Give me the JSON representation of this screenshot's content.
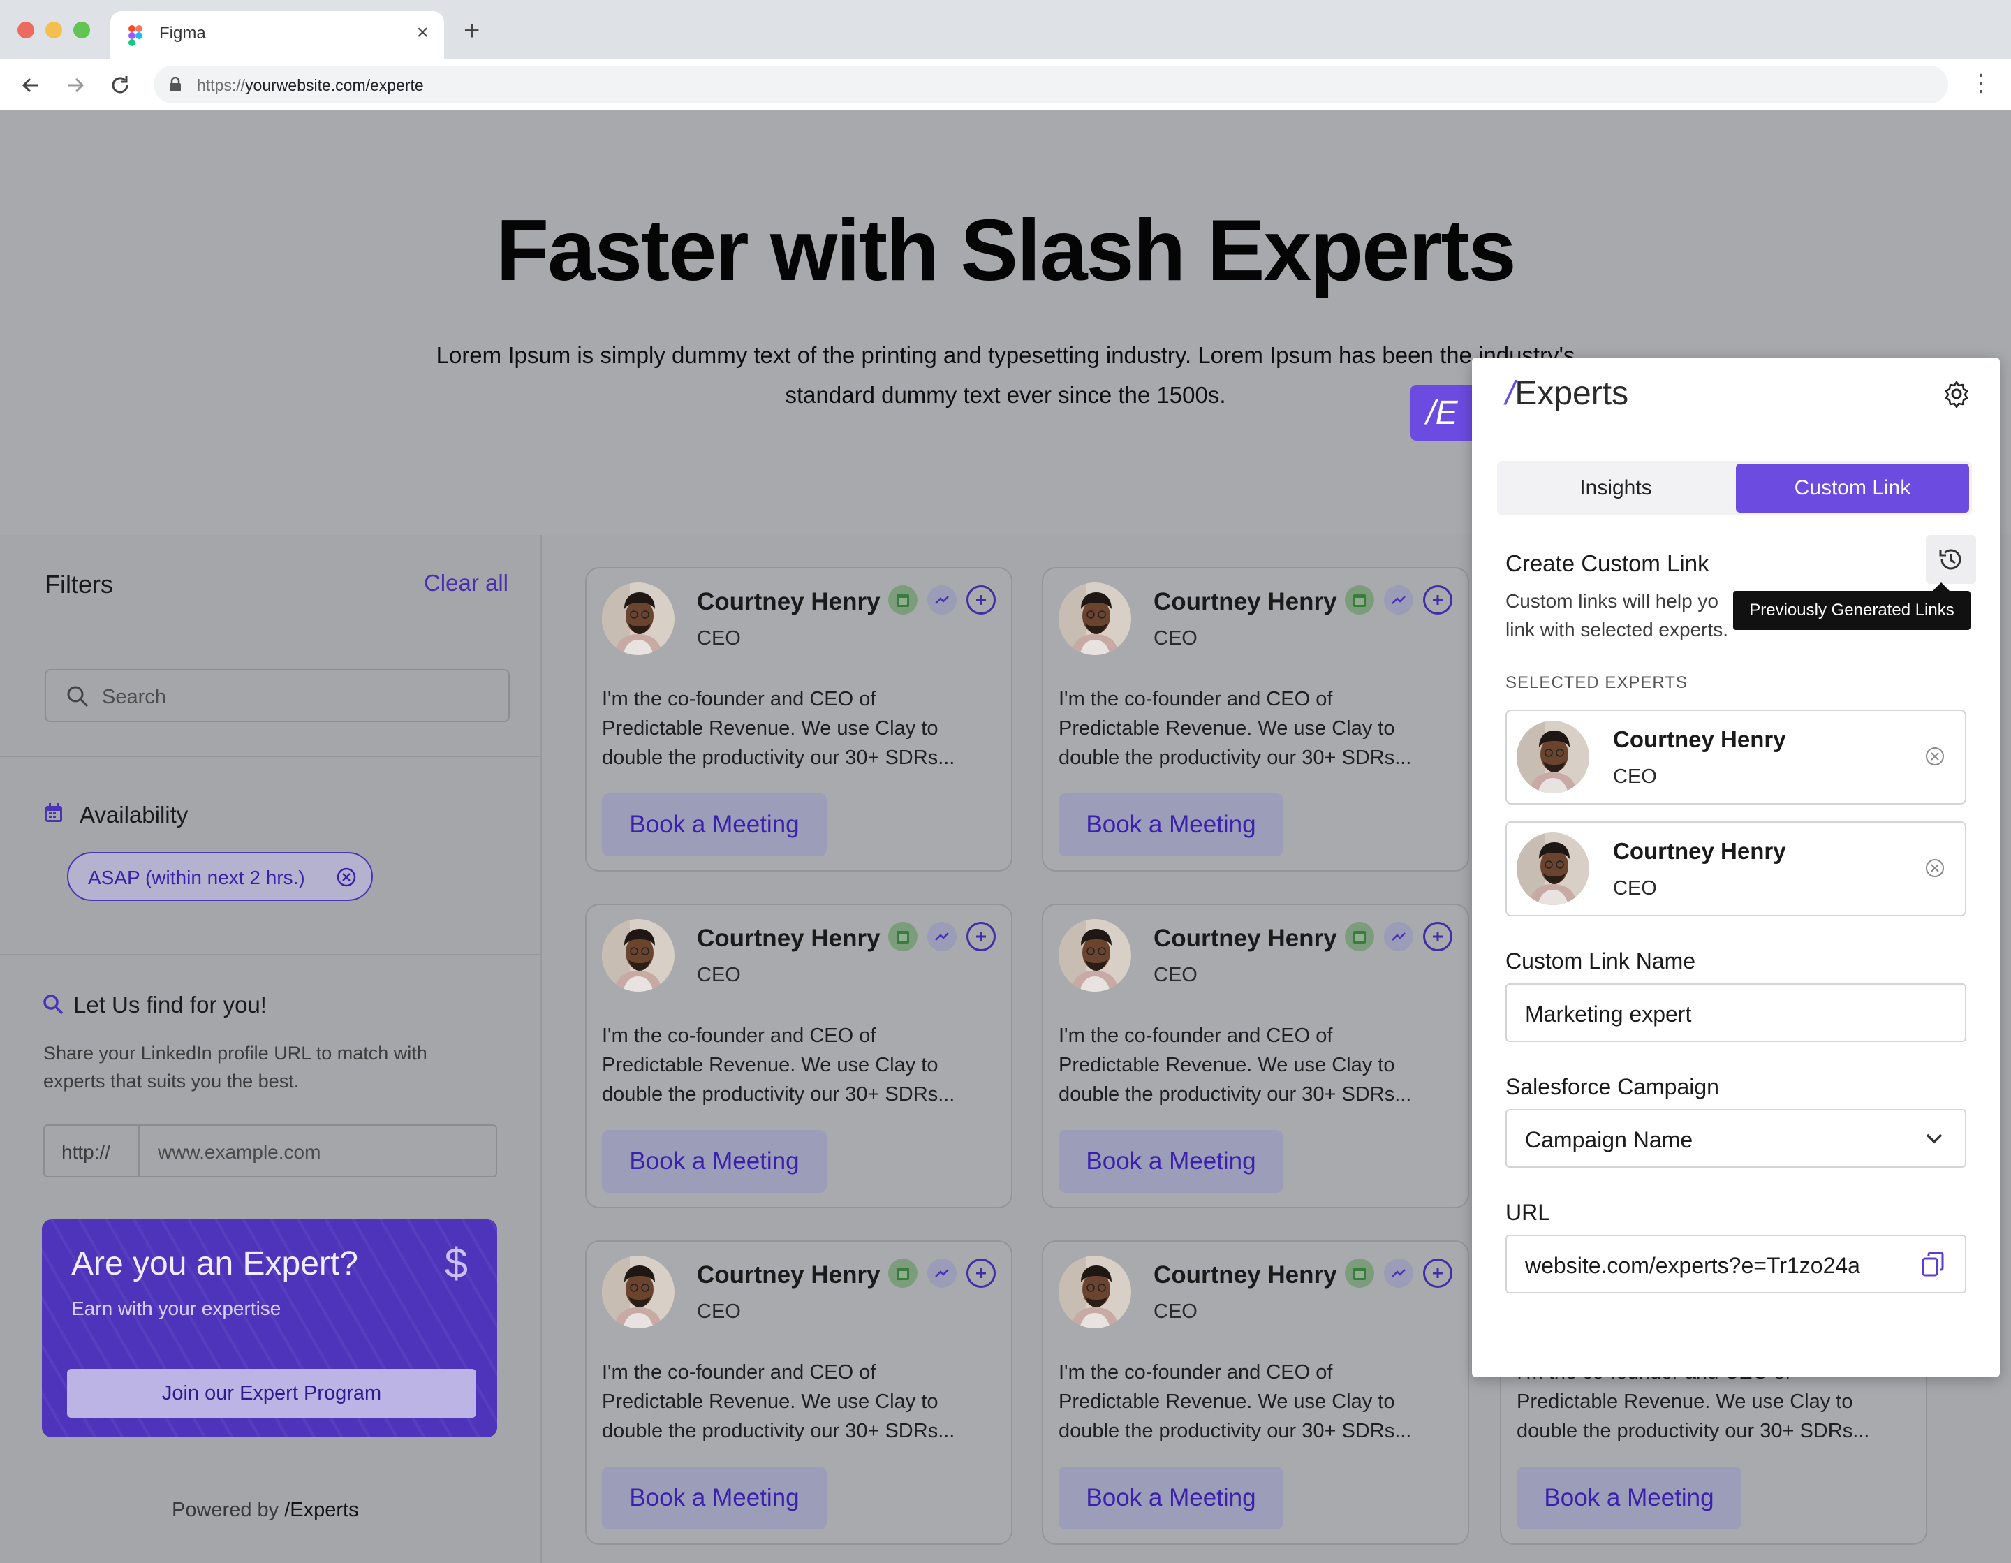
{
  "browser": {
    "tab_title": "Figma",
    "url_prefix": "https://",
    "url_rest": "yourwebsite.com/experte"
  },
  "hero": {
    "title": "Faster with Slash Experts",
    "subtitle_line1": "Lorem Ipsum is simply dummy text of the printing and typesetting industry. Lorem Ipsum has been the industry's",
    "subtitle_line2": "standard dummy text ever since the 1500s.",
    "launcher_glyph": "/E"
  },
  "filters": {
    "title": "Filters",
    "clear_all": "Clear all",
    "search_placeholder": "Search",
    "availability_label": "Availability",
    "availability_chip": "ASAP (within next 2 hrs.)",
    "find_label": "Let Us find for you!",
    "find_desc": "Share your LinkedIn profile URL to match with experts that suits you the best.",
    "linkedin_prefix": "http://",
    "linkedin_placeholder": "www.example.com"
  },
  "promo": {
    "title": "Are you an Expert?",
    "subtitle": "Earn with your expertise",
    "dollar": "$",
    "button": "Join our Expert Program"
  },
  "footer": {
    "powered_by": "Powered by",
    "brand": "/Experts"
  },
  "card": {
    "name": "Courtney Henry",
    "role": "CEO",
    "desc_1": "I'm the co-founder and CEO of",
    "desc_2": "Predictable Revenue. We use Clay to",
    "desc_3": "double the productivity our 30+ SDRs...",
    "book": "Book a Meeting"
  },
  "panel": {
    "logo_slash": "/",
    "logo_text": "Experts",
    "tab_insights": "Insights",
    "tab_custom": "Custom Link",
    "heading": "Create Custom Link",
    "desc_1": "Custom links will help yo",
    "desc_2": "link with selected experts.",
    "tooltip": "Previously Generated Links",
    "selected_label": "SELECTED EXPERTS",
    "selected": [
      {
        "name": "Courtney Henry",
        "role": "CEO"
      },
      {
        "name": "Courtney Henry",
        "role": "CEO"
      }
    ],
    "link_name_label": "Custom Link Name",
    "link_name_value": "Marketing expert",
    "campaign_label": "Salesforce Campaign",
    "campaign_value": "Campaign Name",
    "url_label": "URL",
    "url_value": "website.com/experts?e=Tr1zo24a"
  },
  "colors": {
    "accent": "#6b4be0",
    "accent_dark": "#4d34bb"
  }
}
